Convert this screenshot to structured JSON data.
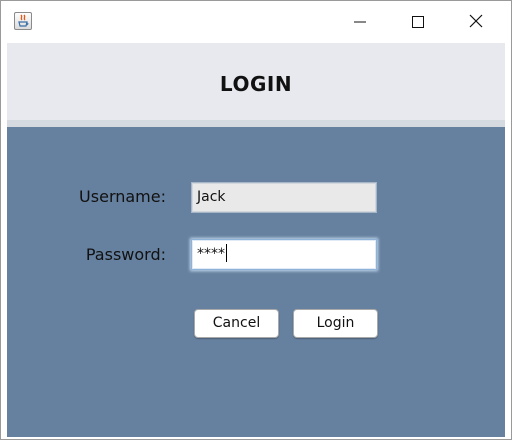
{
  "window": {
    "icon": "java-cup-icon",
    "controls": {
      "minimize_icon": "minimize-icon",
      "maximize_icon": "maximize-icon",
      "close_icon": "close-icon"
    }
  },
  "header": {
    "title": "LOGIN"
  },
  "form": {
    "username_label": "Username:",
    "username_value": "Jack",
    "password_label": "Password:",
    "password_masked": "****",
    "cancel_label": "Cancel",
    "login_label": "Login"
  },
  "colors": {
    "header_background": "#e7e9ee",
    "content_background": "#66809f",
    "username_field_background": "#e9e9e9",
    "password_field_background": "#ffffff"
  }
}
